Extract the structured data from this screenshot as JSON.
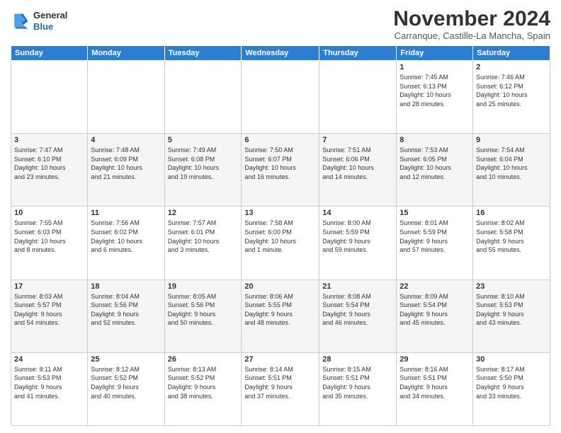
{
  "header": {
    "logo_line1": "General",
    "logo_line2": "Blue",
    "month": "November 2024",
    "location": "Carranque, Castille-La Mancha, Spain"
  },
  "weekdays": [
    "Sunday",
    "Monday",
    "Tuesday",
    "Wednesday",
    "Thursday",
    "Friday",
    "Saturday"
  ],
  "weeks": [
    [
      {
        "day": "",
        "info": ""
      },
      {
        "day": "",
        "info": ""
      },
      {
        "day": "",
        "info": ""
      },
      {
        "day": "",
        "info": ""
      },
      {
        "day": "",
        "info": ""
      },
      {
        "day": "1",
        "info": "Sunrise: 7:45 AM\nSunset: 6:13 PM\nDaylight: 10 hours\nand 28 minutes."
      },
      {
        "day": "2",
        "info": "Sunrise: 7:46 AM\nSunset: 6:12 PM\nDaylight: 10 hours\nand 25 minutes."
      }
    ],
    [
      {
        "day": "3",
        "info": "Sunrise: 7:47 AM\nSunset: 6:10 PM\nDaylight: 10 hours\nand 23 minutes."
      },
      {
        "day": "4",
        "info": "Sunrise: 7:48 AM\nSunset: 6:09 PM\nDaylight: 10 hours\nand 21 minutes."
      },
      {
        "day": "5",
        "info": "Sunrise: 7:49 AM\nSunset: 6:08 PM\nDaylight: 10 hours\nand 19 minutes."
      },
      {
        "day": "6",
        "info": "Sunrise: 7:50 AM\nSunset: 6:07 PM\nDaylight: 10 hours\nand 16 minutes."
      },
      {
        "day": "7",
        "info": "Sunrise: 7:51 AM\nSunset: 6:06 PM\nDaylight: 10 hours\nand 14 minutes."
      },
      {
        "day": "8",
        "info": "Sunrise: 7:53 AM\nSunset: 6:05 PM\nDaylight: 10 hours\nand 12 minutes."
      },
      {
        "day": "9",
        "info": "Sunrise: 7:54 AM\nSunset: 6:04 PM\nDaylight: 10 hours\nand 10 minutes."
      }
    ],
    [
      {
        "day": "10",
        "info": "Sunrise: 7:55 AM\nSunset: 6:03 PM\nDaylight: 10 hours\nand 8 minutes."
      },
      {
        "day": "11",
        "info": "Sunrise: 7:56 AM\nSunset: 6:02 PM\nDaylight: 10 hours\nand 6 minutes."
      },
      {
        "day": "12",
        "info": "Sunrise: 7:57 AM\nSunset: 6:01 PM\nDaylight: 10 hours\nand 3 minutes."
      },
      {
        "day": "13",
        "info": "Sunrise: 7:58 AM\nSunset: 6:00 PM\nDaylight: 10 hours\nand 1 minute."
      },
      {
        "day": "14",
        "info": "Sunrise: 8:00 AM\nSunset: 5:59 PM\nDaylight: 9 hours\nand 59 minutes."
      },
      {
        "day": "15",
        "info": "Sunrise: 8:01 AM\nSunset: 5:59 PM\nDaylight: 9 hours\nand 57 minutes."
      },
      {
        "day": "16",
        "info": "Sunrise: 8:02 AM\nSunset: 5:58 PM\nDaylight: 9 hours\nand 55 minutes."
      }
    ],
    [
      {
        "day": "17",
        "info": "Sunrise: 8:03 AM\nSunset: 5:57 PM\nDaylight: 9 hours\nand 54 minutes."
      },
      {
        "day": "18",
        "info": "Sunrise: 8:04 AM\nSunset: 5:56 PM\nDaylight: 9 hours\nand 52 minutes."
      },
      {
        "day": "19",
        "info": "Sunrise: 8:05 AM\nSunset: 5:56 PM\nDaylight: 9 hours\nand 50 minutes."
      },
      {
        "day": "20",
        "info": "Sunrise: 8:06 AM\nSunset: 5:55 PM\nDaylight: 9 hours\nand 48 minutes."
      },
      {
        "day": "21",
        "info": "Sunrise: 8:08 AM\nSunset: 5:54 PM\nDaylight: 9 hours\nand 46 minutes."
      },
      {
        "day": "22",
        "info": "Sunrise: 8:09 AM\nSunset: 5:54 PM\nDaylight: 9 hours\nand 45 minutes."
      },
      {
        "day": "23",
        "info": "Sunrise: 8:10 AM\nSunset: 5:53 PM\nDaylight: 9 hours\nand 43 minutes."
      }
    ],
    [
      {
        "day": "24",
        "info": "Sunrise: 8:11 AM\nSunset: 5:53 PM\nDaylight: 9 hours\nand 41 minutes."
      },
      {
        "day": "25",
        "info": "Sunrise: 8:12 AM\nSunset: 5:52 PM\nDaylight: 9 hours\nand 40 minutes."
      },
      {
        "day": "26",
        "info": "Sunrise: 8:13 AM\nSunset: 5:52 PM\nDaylight: 9 hours\nand 38 minutes."
      },
      {
        "day": "27",
        "info": "Sunrise: 8:14 AM\nSunset: 5:51 PM\nDaylight: 9 hours\nand 37 minutes."
      },
      {
        "day": "28",
        "info": "Sunrise: 8:15 AM\nSunset: 5:51 PM\nDaylight: 9 hours\nand 35 minutes."
      },
      {
        "day": "29",
        "info": "Sunrise: 8:16 AM\nSunset: 5:51 PM\nDaylight: 9 hours\nand 34 minutes."
      },
      {
        "day": "30",
        "info": "Sunrise: 8:17 AM\nSunset: 5:50 PM\nDaylight: 9 hours\nand 33 minutes."
      }
    ]
  ]
}
